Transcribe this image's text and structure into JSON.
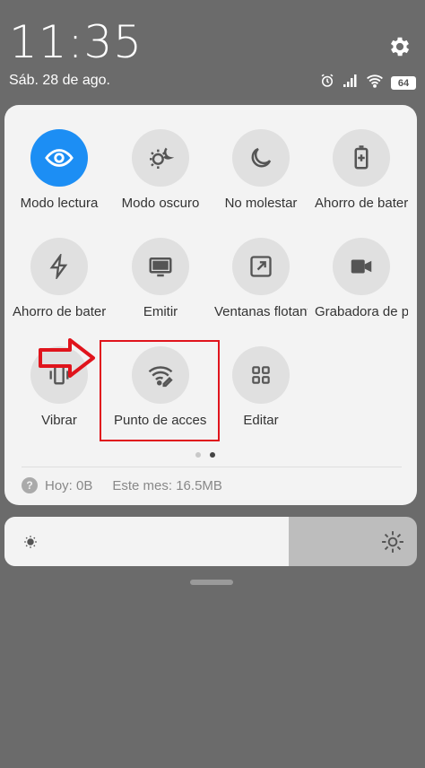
{
  "status_bar": {
    "time": "11:35",
    "date": "Sáb. 28 de ago.",
    "battery": "64"
  },
  "tiles": [
    {
      "label": "Modo lectura",
      "icon": "eye-icon",
      "active": true
    },
    {
      "label": "Modo oscuro",
      "icon": "dark-mode-icon",
      "active": false
    },
    {
      "label": "No molestar",
      "icon": "moon-icon",
      "active": false
    },
    {
      "label": "Ahorro de batería",
      "icon": "battery-saver-icon",
      "active": false
    },
    {
      "label": "Ahorro de batería",
      "icon": "lightning-icon",
      "active": false
    },
    {
      "label": "Emitir",
      "icon": "cast-screen-icon",
      "active": false
    },
    {
      "label": "Ventanas flotantes",
      "icon": "floating-window-icon",
      "active": false
    },
    {
      "label": "Grabadora de pantalla",
      "icon": "video-camera-icon",
      "active": false
    },
    {
      "label": "Vibrar",
      "icon": "vibrate-icon",
      "active": false
    },
    {
      "label": "Punto de acceso",
      "icon": "hotspot-icon",
      "active": false
    },
    {
      "label": "Editar",
      "icon": "grid-icon",
      "active": false
    }
  ],
  "pager": {
    "pages": 2,
    "current": 2
  },
  "data_usage": {
    "today": "Hoy: 0B",
    "month": "Este mes: 16.5MB"
  },
  "brightness": {
    "level": 0.69
  },
  "colors": {
    "accent": "#1c8ef4",
    "highlight": "#e0141c",
    "background": "#6b6b6b",
    "panel": "#f3f3f3"
  }
}
